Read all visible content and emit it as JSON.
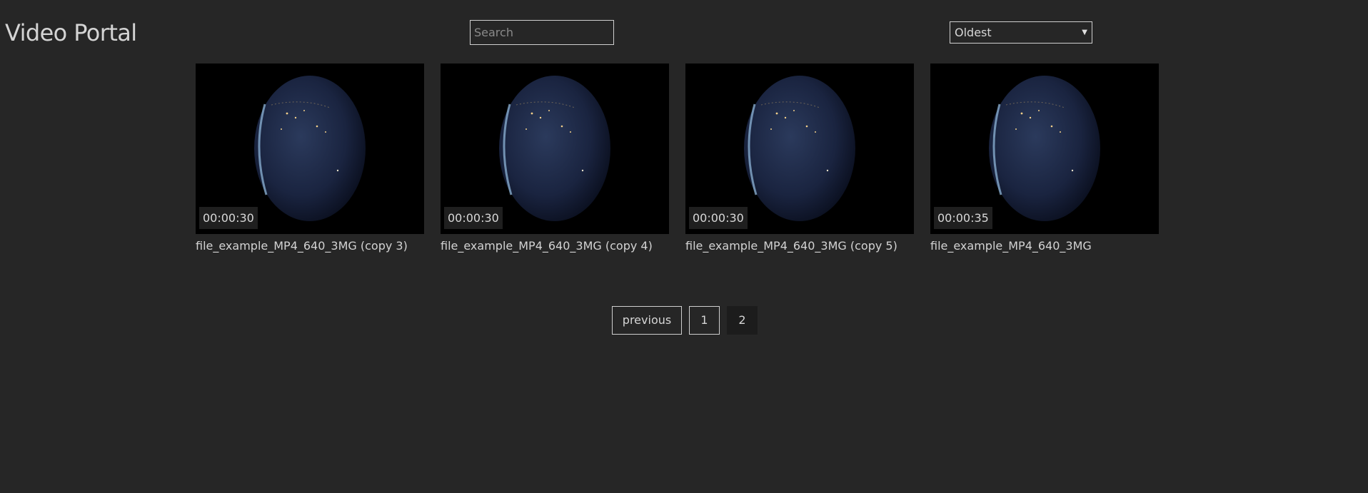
{
  "header": {
    "title": "Video Portal"
  },
  "search": {
    "placeholder": "Search",
    "value": ""
  },
  "sort": {
    "selected": "Oldest"
  },
  "videos": [
    {
      "duration": "00:00:30",
      "title": "file_example_MP4_640_3MG (copy 3)"
    },
    {
      "duration": "00:00:30",
      "title": "file_example_MP4_640_3MG (copy 4)"
    },
    {
      "duration": "00:00:30",
      "title": "file_example_MP4_640_3MG (copy 5)"
    },
    {
      "duration": "00:00:35",
      "title": "file_example_MP4_640_3MG"
    }
  ],
  "pagination": {
    "previous_label": "previous",
    "pages": [
      "1",
      "2"
    ]
  },
  "colors": {
    "background": "#262626",
    "text": "#d6d6d6",
    "border": "#cfcfcf"
  }
}
